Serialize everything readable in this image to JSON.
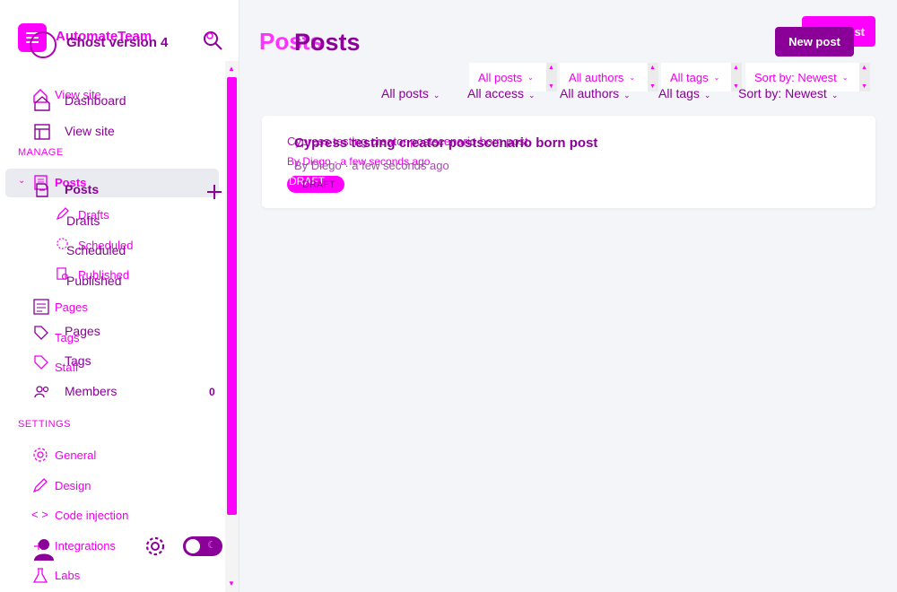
{
  "brand": {
    "name": "AutomateTeam",
    "subtitle": "Ghost version 4"
  },
  "sidebar": {
    "overlay_nav": {
      "view_site": "View site",
      "posts": "Posts",
      "drafts": "Drafts",
      "scheduled": "Scheduled",
      "published": "Published",
      "pages": "Pages",
      "tags": "Tags",
      "staff": "Staff"
    },
    "nav": {
      "dashboard": "Dashboard",
      "view_site": "View site",
      "posts": "Posts",
      "drafts": "Drafts",
      "scheduled": "Scheduled",
      "published": "Published",
      "pages": "Pages",
      "tags": "Tags",
      "members": "Members",
      "members_count": "0"
    },
    "manage_label": "MANAGE",
    "settings_label": "SETTINGS",
    "settings": {
      "general": "General",
      "design": "Design",
      "code_injection": "Code injection",
      "integrations": "Integrations",
      "labs": "Labs"
    }
  },
  "header": {
    "title": "Posts",
    "title_overlay": "Posts",
    "new_post": "New post",
    "new_post_overlay": "ost"
  },
  "filters": {
    "top": [
      "All posts",
      "All authors",
      "All tags",
      "Sort by: Newest"
    ],
    "bottom": [
      "All posts",
      "All access",
      "All authors",
      "All tags",
      "Sort by: Newest"
    ]
  },
  "post": {
    "title": "Cypress testing creator postscenario born post",
    "title_overlay": "Cypress testing creator postscenario born post",
    "meta": "By Diego · a few seconds ago",
    "meta_overlay": "By Diego · a few seconds ago",
    "status": "DRAFT"
  },
  "colors": {
    "accent": "#ff00ff",
    "primary": "#8a0098"
  }
}
